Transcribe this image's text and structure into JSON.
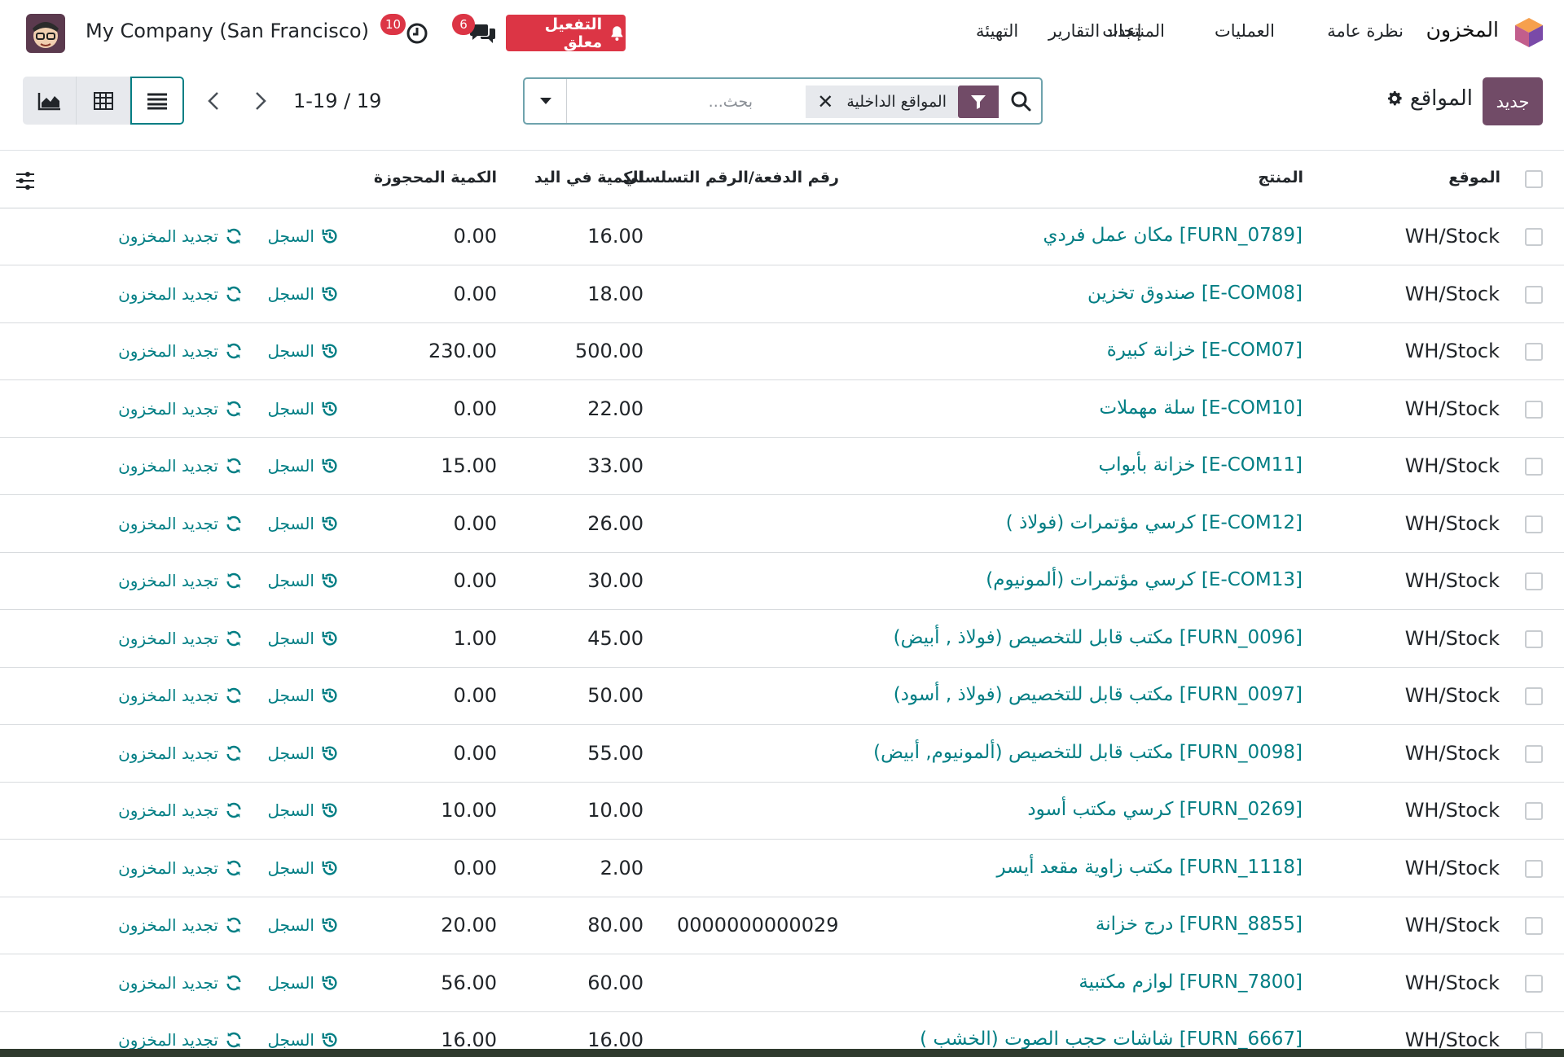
{
  "navbar": {
    "app_name": "المخزون",
    "menu": [
      "نظرة عامة",
      "العمليات",
      "المنتجات",
      "إعداد التقارير",
      "التهيئة"
    ],
    "activation_label": "التفعيل معلق",
    "messages_count": "6",
    "activities_count": "10",
    "company": "My Company (San Francisco)"
  },
  "control": {
    "new_label": "جديد",
    "breadcrumb": "المواقع",
    "facet_label": "المواقع الداخلية",
    "search_placeholder": "بحث...",
    "pager": "1-19 / 19"
  },
  "table": {
    "headers": {
      "location": "الموقع",
      "product": "المنتج",
      "lot": "رقم الدفعة/الرقم التسلسلي",
      "on_hand": "الكمية في اليد",
      "reserved": "الكمية المحجوزة"
    },
    "history_label": "السجل",
    "replenish_label": "تجديد المخزون",
    "rows": [
      {
        "location": "WH/Stock",
        "product": "[FURN_0789] مكان عمل فردي",
        "lot": "",
        "on_hand": "16.00",
        "reserved": "0.00"
      },
      {
        "location": "WH/Stock",
        "product": "[E-COM08] صندوق تخزين",
        "lot": "",
        "on_hand": "18.00",
        "reserved": "0.00"
      },
      {
        "location": "WH/Stock",
        "product": "[E-COM07] خزانة كبيرة",
        "lot": "",
        "on_hand": "500.00",
        "reserved": "230.00"
      },
      {
        "location": "WH/Stock",
        "product": "[E-COM10] سلة مهملات",
        "lot": "",
        "on_hand": "22.00",
        "reserved": "0.00"
      },
      {
        "location": "WH/Stock",
        "product": "[E-COM11] خزانة بأبواب",
        "lot": "",
        "on_hand": "33.00",
        "reserved": "15.00"
      },
      {
        "location": "WH/Stock",
        "product": "[E-COM12] كرسي مؤتمرات (فولاذ )",
        "lot": "",
        "on_hand": "26.00",
        "reserved": "0.00"
      },
      {
        "location": "WH/Stock",
        "product": "[E-COM13] كرسي مؤتمرات (ألمونيوم)",
        "lot": "",
        "on_hand": "30.00",
        "reserved": "0.00"
      },
      {
        "location": "WH/Stock",
        "product": "[FURN_0096] مكتب قابل للتخصيص (فولاذ , أبيض)",
        "lot": "",
        "on_hand": "45.00",
        "reserved": "1.00"
      },
      {
        "location": "WH/Stock",
        "product": "[FURN_0097] مكتب قابل للتخصيص (فولاذ , أسود)",
        "lot": "",
        "on_hand": "50.00",
        "reserved": "0.00"
      },
      {
        "location": "WH/Stock",
        "product": "[FURN_0098] مكتب قابل للتخصيص (ألمونيوم, أبيض)",
        "lot": "",
        "on_hand": "55.00",
        "reserved": "0.00"
      },
      {
        "location": "WH/Stock",
        "product": "[FURN_0269] كرسي مكتب أسود",
        "lot": "",
        "on_hand": "10.00",
        "reserved": "10.00"
      },
      {
        "location": "WH/Stock",
        "product": "[FURN_1118] مكتب زاوية مقعد أيسر",
        "lot": "",
        "on_hand": "2.00",
        "reserved": "0.00"
      },
      {
        "location": "WH/Stock",
        "product": "[FURN_8855] درج خزانة",
        "lot": "0000000000029",
        "on_hand": "80.00",
        "reserved": "20.00"
      },
      {
        "location": "WH/Stock",
        "product": "[FURN_7800] لوازم مكتبية",
        "lot": "",
        "on_hand": "60.00",
        "reserved": "56.00"
      },
      {
        "location": "WH/Stock",
        "product": "[FURN_6667] شاشات حجب الصوت (الخشب )",
        "lot": "",
        "on_hand": "16.00",
        "reserved": "16.00"
      }
    ]
  },
  "colors": {
    "brand": "#714b67",
    "link": "#017e84",
    "danger": "#dc3545"
  }
}
